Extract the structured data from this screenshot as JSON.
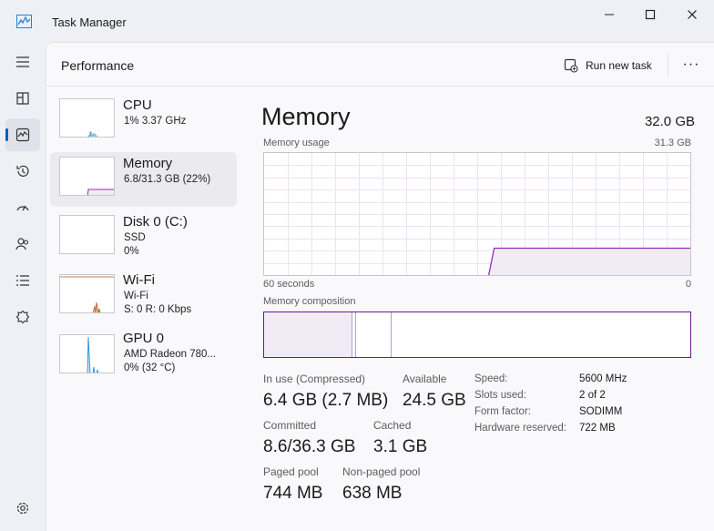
{
  "window": {
    "title": "Task Manager"
  },
  "header": {
    "page_title": "Performance",
    "run_new_task": "Run new task",
    "more": "···"
  },
  "rail": {
    "items": [
      {
        "icon": "hamburger-menu-icon"
      },
      {
        "icon": "processes-icon"
      },
      {
        "icon": "performance-icon",
        "active": true
      },
      {
        "icon": "app-history-icon"
      },
      {
        "icon": "startup-apps-icon"
      },
      {
        "icon": "users-icon"
      },
      {
        "icon": "details-icon"
      },
      {
        "icon": "services-icon"
      },
      {
        "icon": "settings-icon"
      }
    ]
  },
  "sidebar": {
    "items": [
      {
        "name": "CPU",
        "line1": "1% 3.37 GHz",
        "line2": ""
      },
      {
        "name": "Memory",
        "line1": "6.8/31.3 GB (22%)",
        "line2": "",
        "active": true
      },
      {
        "name": "Disk 0 (C:)",
        "line1": "SSD",
        "line2": "0%"
      },
      {
        "name": "Wi-Fi",
        "line1": "Wi-Fi",
        "line2": "S: 0 R: 0 Kbps"
      },
      {
        "name": "GPU 0",
        "line1": "AMD Radeon 780...",
        "line2": "0% (32 °C)"
      }
    ]
  },
  "memory": {
    "title": "Memory",
    "total": "32.0 GB",
    "usage_label": "Memory usage",
    "usage_max": "31.3 GB",
    "axis_left": "60 seconds",
    "axis_right": "0",
    "composition_label": "Memory composition",
    "usage_fraction": 0.22,
    "composition": {
      "in_use_fraction": 0.208,
      "modified_fraction": 0.007,
      "standby_fraction": 0.085
    },
    "stats": {
      "in_use_label": "In use (Compressed)",
      "in_use_value": "6.4 GB (2.7 MB)",
      "available_label": "Available",
      "available_value": "24.5 GB",
      "committed_label": "Committed",
      "committed_value": "8.6/36.3 GB",
      "cached_label": "Cached",
      "cached_value": "3.1 GB",
      "paged_label": "Paged pool",
      "paged_value": "744 MB",
      "nonpaged_label": "Non-paged pool",
      "nonpaged_value": "638 MB"
    },
    "details": [
      {
        "key": "Speed:",
        "value": "5600 MHz"
      },
      {
        "key": "Slots used:",
        "value": "2 of 2"
      },
      {
        "key": "Form factor:",
        "value": "SODIMM"
      },
      {
        "key": "Hardware reserved:",
        "value": "722 MB"
      }
    ]
  },
  "colors": {
    "accent": "#005fb8",
    "memory": "#8e32b0",
    "memory_fill": "#f1ebf6",
    "cpu": "#2a8ad4",
    "disk": "#4c9b3b",
    "wifi": "#b5561f"
  }
}
